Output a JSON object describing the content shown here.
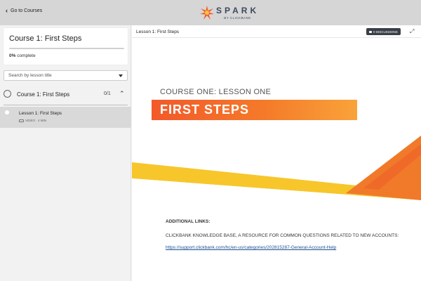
{
  "topbar": {
    "back_label": "Go to Courses",
    "brand_name": "SPARK",
    "brand_sub": "BY CLICKBANK",
    "brand_color": "#f2592a"
  },
  "sidebar": {
    "course_title": "Course 1: First Steps",
    "progress_percent": "0%",
    "progress_suffix": " complete",
    "search_placeholder": "Search by lesson title",
    "section": {
      "title": "Course 1: First Steps",
      "count": "0/1"
    },
    "lessons": [
      {
        "title": "Lesson 1: First Steps",
        "meta": "VIDEO · 4 MIN",
        "active": true
      }
    ]
  },
  "main": {
    "lesson_title": "Lesson 1: First Steps",
    "discussions_label": "0 DISCUSSIONS",
    "slide": {
      "subtitle": "COURSE ONE: LESSON ONE",
      "title": "FIRST STEPS"
    },
    "links": {
      "heading": "ADDITIONAL LINKS:",
      "description": "CLICKBANK KNOWLEDGE BASE, A RESOURCE FOR COMMON QUESTIONS RELATED TO NEW ACCOUNTS:",
      "url": "https://support.clickbank.com/hc/en-us/categories/202815287-General-Account-Help"
    }
  }
}
